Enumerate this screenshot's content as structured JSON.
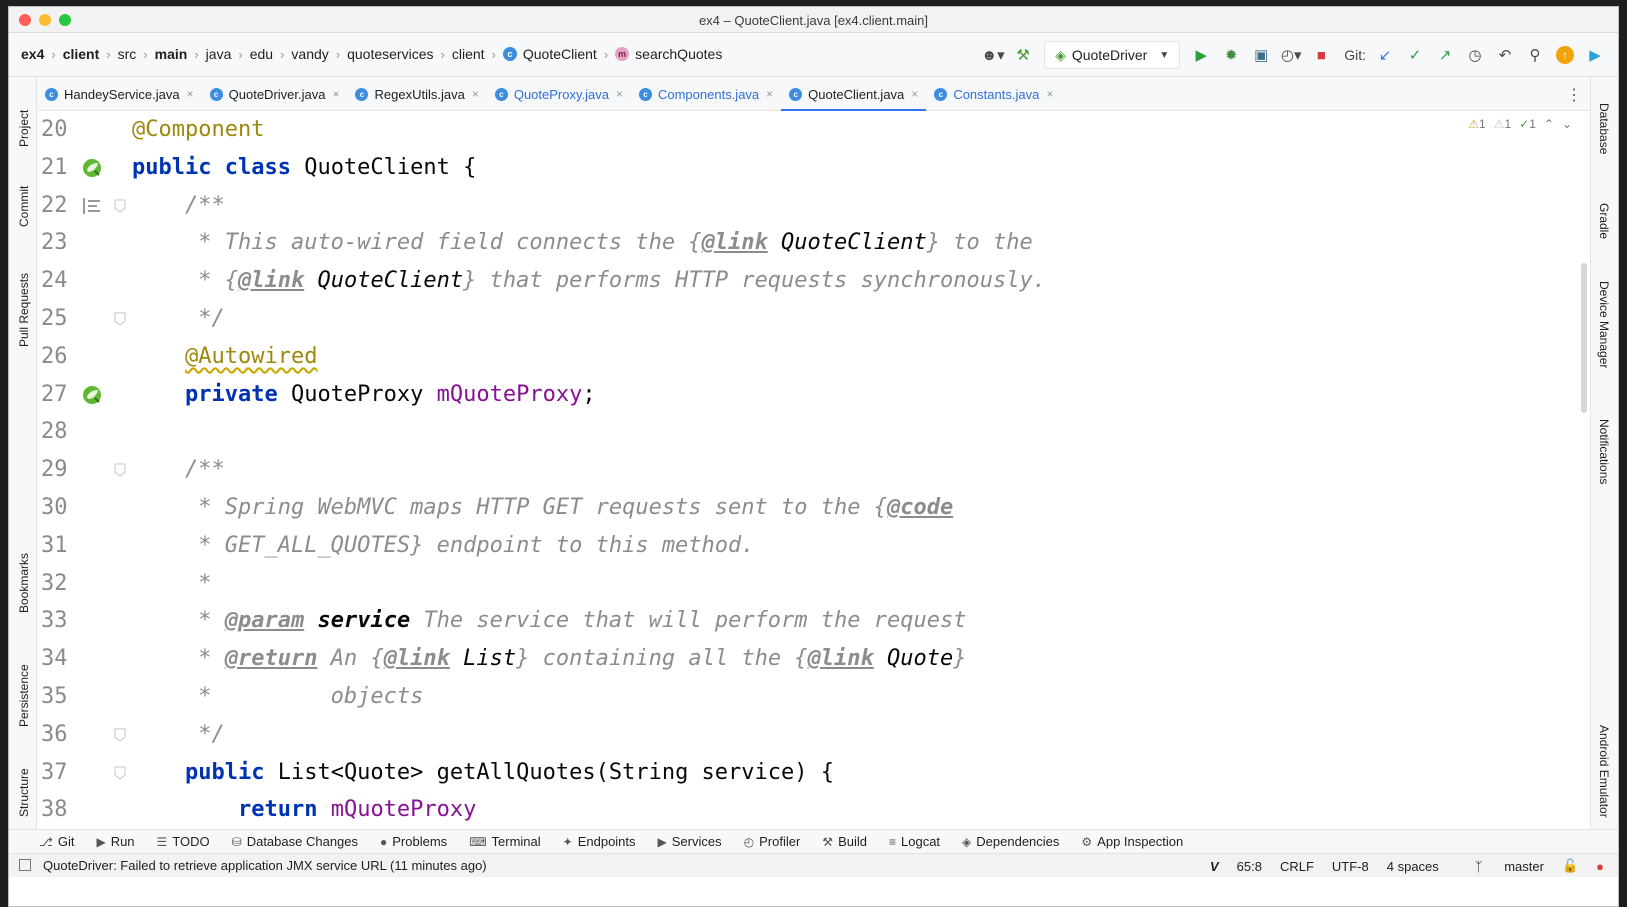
{
  "window": {
    "title": "ex4 – QuoteClient.java [ex4.client.main]"
  },
  "breadcrumbs": [
    {
      "label": "ex4",
      "bold": true,
      "icon": ""
    },
    {
      "label": "client",
      "bold": true,
      "icon": ""
    },
    {
      "label": "src",
      "bold": false,
      "icon": ""
    },
    {
      "label": "main",
      "bold": true,
      "icon": ""
    },
    {
      "label": "java",
      "bold": false,
      "icon": ""
    },
    {
      "label": "edu",
      "bold": false,
      "icon": ""
    },
    {
      "label": "vandy",
      "bold": false,
      "icon": ""
    },
    {
      "label": "quoteservices",
      "bold": false,
      "icon": ""
    },
    {
      "label": "client",
      "bold": false,
      "icon": ""
    },
    {
      "label": "QuoteClient",
      "bold": false,
      "icon": "class-icon"
    },
    {
      "label": "searchQuotes",
      "bold": false,
      "icon": "method-icon"
    }
  ],
  "toolbar": {
    "run_config": "QuoteDriver",
    "git_label": "Git:"
  },
  "tabs": [
    {
      "label": "HandeyService.java",
      "modified": false,
      "active": false
    },
    {
      "label": "QuoteDriver.java",
      "modified": false,
      "active": false
    },
    {
      "label": "RegexUtils.java",
      "modified": false,
      "active": false
    },
    {
      "label": "QuoteProxy.java",
      "modified": true,
      "active": false
    },
    {
      "label": "Components.java",
      "modified": true,
      "active": false
    },
    {
      "label": "QuoteClient.java",
      "modified": false,
      "active": true
    },
    {
      "label": "Constants.java",
      "modified": true,
      "active": false
    }
  ],
  "left_stripe": [
    "Project",
    "Commit",
    "Pull Requests",
    "Bookmarks",
    "Persistence",
    "Structure"
  ],
  "right_stripe": [
    "Database",
    "Gradle",
    "Device Manager",
    "Notifications",
    "Android Emulator"
  ],
  "indicators": {
    "warnings": "1",
    "weak_warnings": "1",
    "typos": "1"
  },
  "editor_lines": [
    {
      "n": "20",
      "html": "<span class='ann'>@Component</span>"
    },
    {
      "n": "21",
      "html": "<span class='kw'>public class</span> QuoteClient {"
    },
    {
      "n": "22",
      "html": "    <span class='cmt'>/**</span>"
    },
    {
      "n": "23",
      "html": "     <span class='cmt'>* This auto-wired field connects the {</span><span class='tag'>@link</span> <span class='ref'>QuoteClient</span><span class='cmt'>} to the</span>"
    },
    {
      "n": "24",
      "html": "     <span class='cmt'>* {</span><span class='tag'>@link</span> <span class='ref'>QuoteClient</span><span class='cmt'>} that performs HTTP requests synchronously.</span>"
    },
    {
      "n": "25",
      "html": "     <span class='cmt'>*/</span>"
    },
    {
      "n": "26",
      "html": "    <span class='ann wavy'>@Autowired</span>"
    },
    {
      "n": "27",
      "html": "    <span class='kw'>private</span> QuoteProxy <span class='field'>mQuoteProxy</span>;"
    },
    {
      "n": "28",
      "html": ""
    },
    {
      "n": "29",
      "html": "    <span class='cmt'>/**</span>"
    },
    {
      "n": "30",
      "html": "     <span class='cmt'>* Spring WebMVC maps HTTP GET requests sent to the {</span><span class='tag'>@code</span>"
    },
    {
      "n": "31",
      "html": "     <span class='cmt'>* GET_ALL_QUOTES} endpoint to this method.</span>"
    },
    {
      "n": "32",
      "html": "     <span class='cmt'>*</span>"
    },
    {
      "n": "33",
      "html": "     <span class='cmt'>* </span><span class='tag'>@param</span> <span class='pbold'>service</span> <span class='cmt'>The service that will perform the request</span>"
    },
    {
      "n": "34",
      "html": "     <span class='cmt'>* </span><span class='tag'>@return</span> <span class='cmt'>An {</span><span class='tag'>@link</span> <span class='ref'>List</span><span class='cmt'>} containing all the {</span><span class='tag'>@link</span> <span class='ref'>Quote</span><span class='cmt'>}</span>"
    },
    {
      "n": "35",
      "html": "     <span class='cmt'>*         objects</span>"
    },
    {
      "n": "36",
      "html": "     <span class='cmt'>*/</span>"
    },
    {
      "n": "37",
      "html": "    <span class='kw'>public</span> List&lt;Quote&gt; getAllQuotes(String service) {"
    },
    {
      "n": "38",
      "html": "        <span class='kw'>return</span> <span class='field'>mQuoteProxy</span>"
    }
  ],
  "gutter_icons": {
    "21": "spring-bean-icon",
    "22": "doc-render-icon",
    "27": "spring-bean-icon"
  },
  "fold_markers": [
    "22",
    "25",
    "29",
    "36",
    "37"
  ],
  "tool_windows": [
    {
      "label": "Git",
      "icon": "git-icon"
    },
    {
      "label": "Run",
      "icon": "run-icon"
    },
    {
      "label": "TODO",
      "icon": "todo-icon"
    },
    {
      "label": "Database Changes",
      "icon": "database-changes-icon"
    },
    {
      "label": "Problems",
      "icon": "problems-icon"
    },
    {
      "label": "Terminal",
      "icon": "terminal-icon"
    },
    {
      "label": "Endpoints",
      "icon": "endpoints-icon"
    },
    {
      "label": "Services",
      "icon": "services-icon"
    },
    {
      "label": "Profiler",
      "icon": "profiler-icon"
    },
    {
      "label": "Build",
      "icon": "build-icon"
    },
    {
      "label": "Logcat",
      "icon": "logcat-icon"
    },
    {
      "label": "Dependencies",
      "icon": "dependencies-icon"
    },
    {
      "label": "App Inspection",
      "icon": "app-inspection-icon"
    }
  ],
  "status": {
    "message": "QuoteDriver: Failed to retrieve application JMX service URL (11 minutes ago)",
    "position": "65:8",
    "line_separator": "CRLF",
    "encoding": "UTF-8",
    "indent": "4 spaces",
    "branch": "master"
  },
  "colors": {
    "accent": "#3574f0",
    "keyword": "#0033b3",
    "annotation": "#9e880d",
    "field": "#871094",
    "comment": "#8c8c8c"
  }
}
